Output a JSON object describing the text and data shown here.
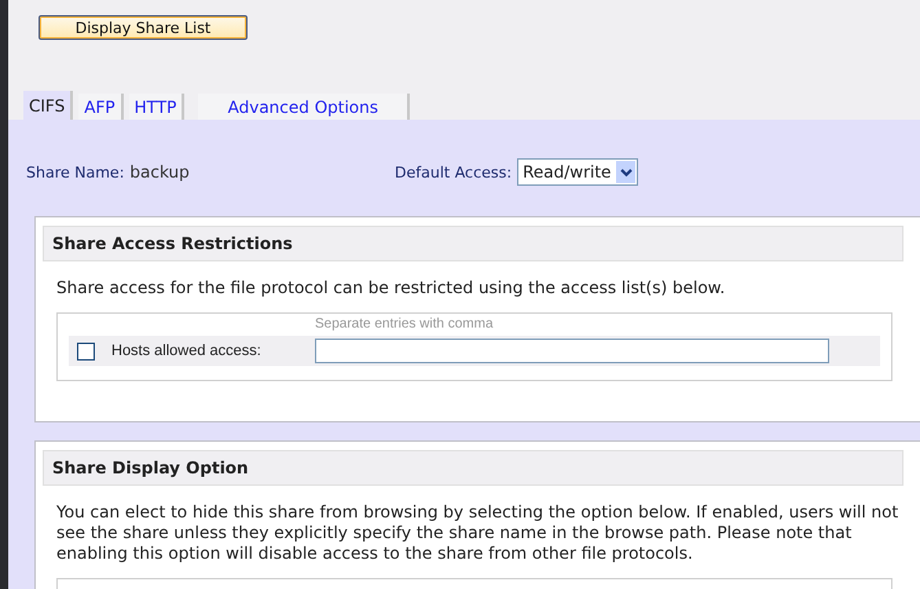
{
  "top_button": "Display Share List",
  "tabs": [
    {
      "label": "CIFS",
      "selected": true
    },
    {
      "label": "AFP",
      "selected": false
    },
    {
      "label": "HTTP",
      "selected": false
    },
    {
      "label": "Advanced Options",
      "selected": false
    }
  ],
  "share_name": {
    "label": "Share Name:",
    "value": "backup"
  },
  "default_access": {
    "label": "Default Access:",
    "value": "Read/write"
  },
  "sections": [
    {
      "title": "Share Access Restrictions",
      "description": "Share access for the file protocol can be restricted using the access list(s) below.",
      "hint": "Separate entries with comma",
      "option": {
        "label": "Hosts allowed access:",
        "checked": false
      }
    },
    {
      "title": "Share Display Option",
      "description": "You can elect to hide this share from browsing by selecting the option below. If enabled, users will not see the share unless they explicitly specify the share name in the browse path. Please note that enabling this option will disable access to the share from other file protocols."
    }
  ]
}
